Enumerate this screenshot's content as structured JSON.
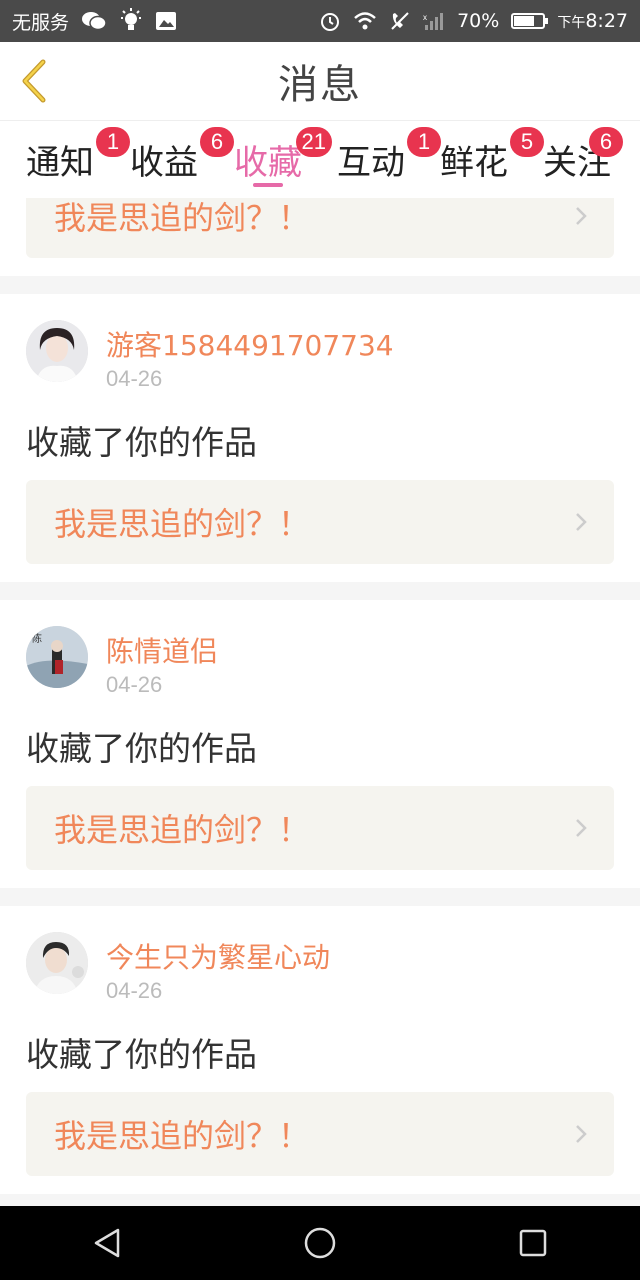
{
  "status_bar": {
    "carrier": "无服务",
    "battery": "70%",
    "battery_level": 0.7,
    "time_prefix": "下午",
    "time": "8:27"
  },
  "header": {
    "title": "消息"
  },
  "tabs": [
    {
      "label": "通知",
      "badge": "1"
    },
    {
      "label": "收益",
      "badge": "6"
    },
    {
      "label": "收藏",
      "badge": "21",
      "active": true
    },
    {
      "label": "互动",
      "badge": "1"
    },
    {
      "label": "鲜花",
      "badge": "5"
    },
    {
      "label": "关注",
      "badge": "6"
    }
  ],
  "partial_card": {
    "work_title": "我是思追的剑？！"
  },
  "items": [
    {
      "username": "游客1584491707734",
      "date": "04-26",
      "action": "收藏了你的作品",
      "work_title": "我是思追的剑？！"
    },
    {
      "username": "陈情道侣",
      "date": "04-26",
      "action": "收藏了你的作品",
      "work_title": "我是思追的剑？！"
    },
    {
      "username": "今生只为繁星心动",
      "date": "04-26",
      "action": "收藏了你的作品",
      "work_title": "我是思追的剑？！"
    }
  ],
  "colors": {
    "accent_pink": "#e66aa8",
    "username_orange": "#f0875a",
    "badge_red": "#e8344f"
  }
}
